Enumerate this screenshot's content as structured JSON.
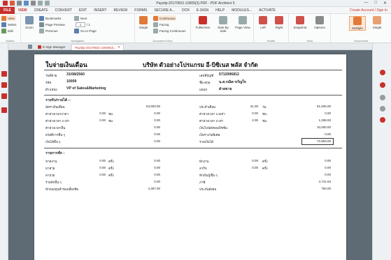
{
  "window": {
    "title": "Payslip-20170831-10009(3).PDF  -  PDF Architect 5",
    "min": "—",
    "max": "□",
    "close": "✕"
  },
  "menu": {
    "file": "FILE",
    "items": [
      "VIEW",
      "CREATE",
      "CONVERT",
      "EDIT",
      "INSERT",
      "REVIEW",
      "FORMS",
      "SECURE A...",
      "OCR",
      "E-SIGN",
      "HELP",
      "MODULES...",
      "ACTIVATE"
    ],
    "active": "VIEW",
    "account": "Create Account / Sign In"
  },
  "ribbon": {
    "modes": {
      "view": "View",
      "select": "Select",
      "edit": "Edit",
      "label": "Modes"
    },
    "navigation": {
      "zoom": "Zoom",
      "bookmarks": "Bookmarks",
      "next": "Next",
      "page_preview": "Page Preview",
      "previous": "Previous",
      "go_to_page": "Go to Page",
      "page_value": "1",
      "page_total": "/ 1",
      "label": "Navigation"
    },
    "docview": {
      "single": "Single",
      "continuous": "Continuous",
      "facing": "Facing",
      "facing_continuous": "Facing Continuous",
      "label": "Document View"
    },
    "others": {
      "fullscreen": "Fullscreen",
      "side_by_side": "Side By Side",
      "page_view": "Page View"
    },
    "rotate": {
      "left": "Left",
      "right": "Right",
      "label": "Rotate"
    },
    "tools": {
      "snapshot": "Snapshot",
      "options": "Options",
      "label": "Tools"
    },
    "documents": {
      "multiple": "Multiple",
      "single": "Single",
      "label": "Documents"
    }
  },
  "tabs": {
    "esign": "E-Sign Manager",
    "doc": "Payslip-20170831-10009(3)...",
    "close": "✕"
  },
  "doc": {
    "title": "ใบจ่ายเงินเดือน",
    "company": "บริษัท ตัวอย่างโปรแกรม อี-บิซิเนส พลัส จำกัด",
    "info": [
      {
        "label": "วันที่จ่าย",
        "value": "31/08/2560",
        "rlabel": "เลขที่บัญชี",
        "rvalue": "5712096812"
      },
      {
        "label": "รหัส",
        "value": "10009",
        "rlabel": "ชื่อ-สกุล",
        "rvalue": "น.ส.กณิต ขวัญใจ"
      },
      {
        "label": "ตำแหน่ง",
        "value": "VP of Sales&Marketing",
        "rlabel": "แผนก",
        "rvalue": "ฝ่ายขาย"
      }
    ],
    "income_header": "รายรับ/รายได้ :-",
    "income_left": [
      {
        "label": "อัตราเงินเดือน",
        "qty": "",
        "unit": "",
        "amount": "53,500.00"
      },
      {
        "label": "ค่าล่วงเวลา/เวลา",
        "qty": "0.00",
        "unit": "ชม.",
        "amount": "0.00"
      },
      {
        "label": "ค่าล่วงเวลา 2 เท่า",
        "qty": "0.00",
        "unit": "ชม.",
        "amount": "0.00"
      },
      {
        "label": "ค่าล่วงเวลาอื่น",
        "qty": "",
        "unit": "",
        "amount": "0.00"
      },
      {
        "label": "สวัสดิการอื่น ๆ",
        "qty": "",
        "unit": "",
        "amount": "0.00"
      },
      {
        "label": "เงินได้อื่น ๆ",
        "qty": "",
        "unit": "",
        "amount": "0.00"
      }
    ],
    "income_right": [
      {
        "label": "ประจำเดือน",
        "qty": "31.00",
        "unit": "วัน",
        "amount": "61,525.00"
      },
      {
        "label": "ค่าล่วงเวลา 1.5เท่า",
        "qty": "0.00",
        "unit": "ชม.",
        "amount": "0.00"
      },
      {
        "label": "ค่าล่วงเวลา 3 เท่า",
        "qty": "2.00",
        "unit": "ชม.",
        "amount": "1,338.00"
      },
      {
        "label": "เงินโบนัส/คอมมิชชั่น",
        "qty": "",
        "unit": "",
        "amount": "10,000.00"
      },
      {
        "label": "เงินรางวัลพิเศษ",
        "qty": "",
        "unit": "",
        "amount": "0.00"
      },
      {
        "label": "รวมเงินได้",
        "qty": "",
        "unit": "",
        "amount": "72,863.00"
      }
    ],
    "deduct_header": "รายการหัก :",
    "deduct_left": [
      {
        "label": "ขาดงาน",
        "qty": "0.00",
        "unit": "ครั้ง",
        "amount": "0.00"
      },
      {
        "label": "มาสาย",
        "qty": "0.00",
        "unit": "ครั้ง",
        "amount": "0.00"
      },
      {
        "label": "ลาป่วย",
        "qty": "0.00",
        "unit": "ครั้ง",
        "amount": "0.00"
      },
      {
        "label": "รายหักอื่น ๆ",
        "qty": "",
        "unit": "",
        "amount": "0.00"
      },
      {
        "label": "หักกองทุนสำรองเลี้ยงชีพ",
        "qty": "",
        "unit": "",
        "amount": "4,307.00"
      }
    ],
    "deduct_right": [
      {
        "label": "พักงาน",
        "qty": "0.00",
        "unit": "ครั้ง",
        "amount": "0.00"
      },
      {
        "label": "ลากิจ",
        "qty": "0.00",
        "unit": "ครั้ง",
        "amount": "0.00"
      },
      {
        "label": "หักเงินกู้/ยืม ๆ",
        "qty": "",
        "unit": "",
        "amount": "0.00"
      },
      {
        "label": "ภาษี",
        "qty": "",
        "unit": "",
        "amount": "4,741.63"
      },
      {
        "label": "ประกันสังคม",
        "qty": "",
        "unit": "",
        "amount": "750.00"
      }
    ]
  },
  "colors": {
    "accent": "#c8302c",
    "ribbon_sel": "#fde7d5",
    "doc_bg": "#5f6b74",
    "frame": "#98b6b3"
  }
}
